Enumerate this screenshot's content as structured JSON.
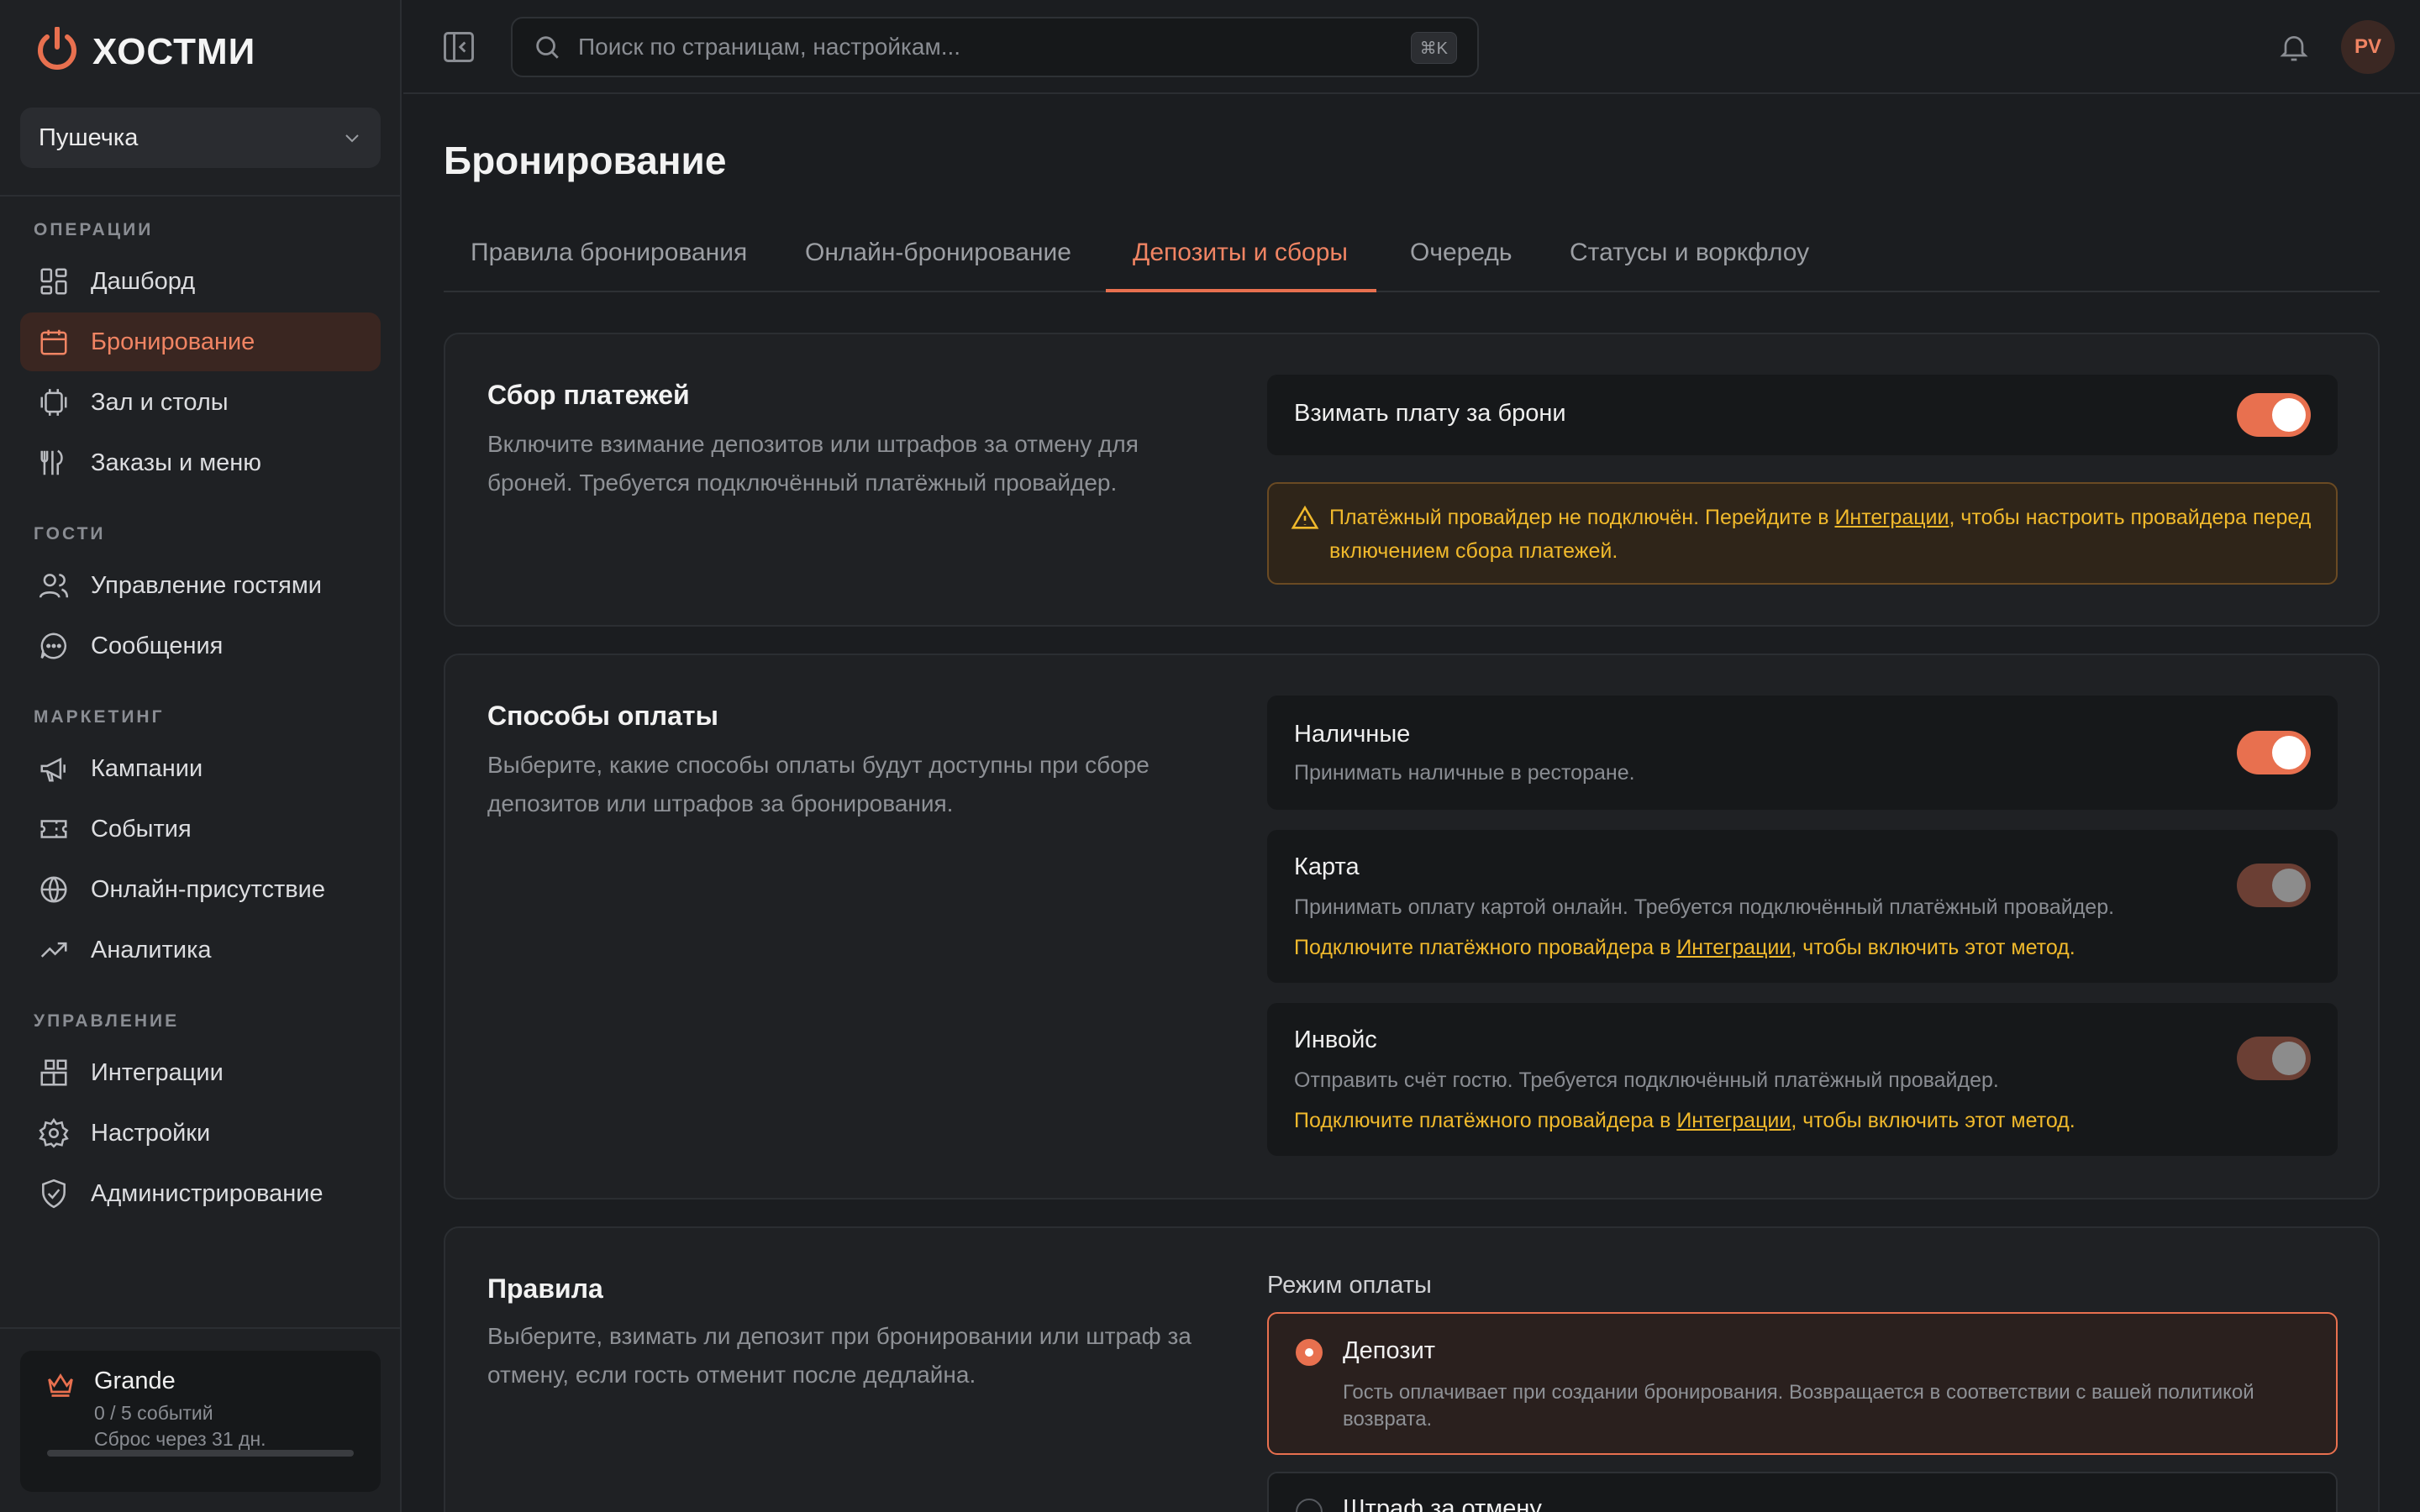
{
  "brand": {
    "name": "ХОСТМИ",
    "accent": "#e8704f"
  },
  "workspace": {
    "name": "Пушечка"
  },
  "sidebar": {
    "sections": [
      {
        "title": "ОПЕРАЦИИ",
        "items": [
          {
            "label": "Дашборд",
            "icon": "dashboard-icon"
          },
          {
            "label": "Бронирование",
            "icon": "calendar-icon",
            "active": true
          },
          {
            "label": "Зал и столы",
            "icon": "tables-icon"
          },
          {
            "label": "Заказы и меню",
            "icon": "cutlery-icon"
          }
        ]
      },
      {
        "title": "ГОСТИ",
        "items": [
          {
            "label": "Управление гостями",
            "icon": "users-icon"
          },
          {
            "label": "Сообщения",
            "icon": "chat-icon"
          }
        ]
      },
      {
        "title": "МАРКЕТИНГ",
        "items": [
          {
            "label": "Кампании",
            "icon": "megaphone-icon"
          },
          {
            "label": "События",
            "icon": "ticket-icon"
          },
          {
            "label": "Онлайн-присутствие",
            "icon": "globe-icon"
          },
          {
            "label": "Аналитика",
            "icon": "trend-icon"
          }
        ]
      },
      {
        "title": "УПРАВЛЕНИЕ",
        "items": [
          {
            "label": "Интеграции",
            "icon": "integrations-icon"
          },
          {
            "label": "Настройки",
            "icon": "gear-icon"
          },
          {
            "label": "Администрирование",
            "icon": "shield-icon"
          }
        ]
      }
    ]
  },
  "plan": {
    "name": "Grande",
    "usage": "0 / 5 событий",
    "reset": "Сброс через 31 дн.",
    "progress": 0
  },
  "topbar": {
    "search_placeholder": "Поиск по страницам, настройкам...",
    "shortcut": "⌘K",
    "avatar_initials": "PV"
  },
  "page": {
    "title": "Бронирование",
    "tabs": [
      "Правила бронирования",
      "Онлайн-бронирование",
      "Депозиты и сборы",
      "Очередь",
      "Статусы и воркфлоу"
    ],
    "active_tab": "Депозиты и сборы"
  },
  "payments": {
    "title": "Сбор платежей",
    "description": "Включите взимание депозитов или штрафов за отмену для броней. Требуется подключённый платёжный провайдер.",
    "toggle_label": "Взимать плату за брони",
    "toggle_on": true,
    "warning_before": "Платёжный провайдер не подключён. Перейдите в ",
    "warning_link": "Интеграции",
    "warning_after": ", чтобы настроить провайдера перед включением сбора платежей."
  },
  "methods": {
    "title": "Способы оплаты",
    "description": "Выберите, какие способы оплаты будут доступны при сборе депозитов или штрафов за бронирования.",
    "items": [
      {
        "title": "Наличные",
        "subtitle": "Принимать наличные в ресторане.",
        "enabled": true
      },
      {
        "title": "Карта",
        "subtitle": "Принимать оплату картой онлайн. Требуется подключённый платёжный провайдер.",
        "enabled": false,
        "warn_before": "Подключите платёжного провайдера в ",
        "warn_link": "Интеграции",
        "warn_after": ", чтобы включить этот метод."
      },
      {
        "title": "Инвойс",
        "subtitle": "Отправить счёт гостю. Требуется подключённый платёжный провайдер.",
        "enabled": false,
        "warn_before": "Подключите платёжного провайдера в ",
        "warn_link": "Интеграции",
        "warn_after": ", чтобы включить этот метод."
      }
    ]
  },
  "rules": {
    "title": "Правила",
    "description": "Выберите, взимать ли депозит при бронировании или штраф за отмену, если гость отменит после дедлайна.",
    "mode_label": "Режим оплаты",
    "options": [
      {
        "title": "Депозит",
        "description": "Гость оплачивает при создании бронирования. Возвращается в соответствии с вашей политикой возврата.",
        "selected": true
      },
      {
        "title": "Штраф за отмену",
        "selected": false
      }
    ]
  }
}
